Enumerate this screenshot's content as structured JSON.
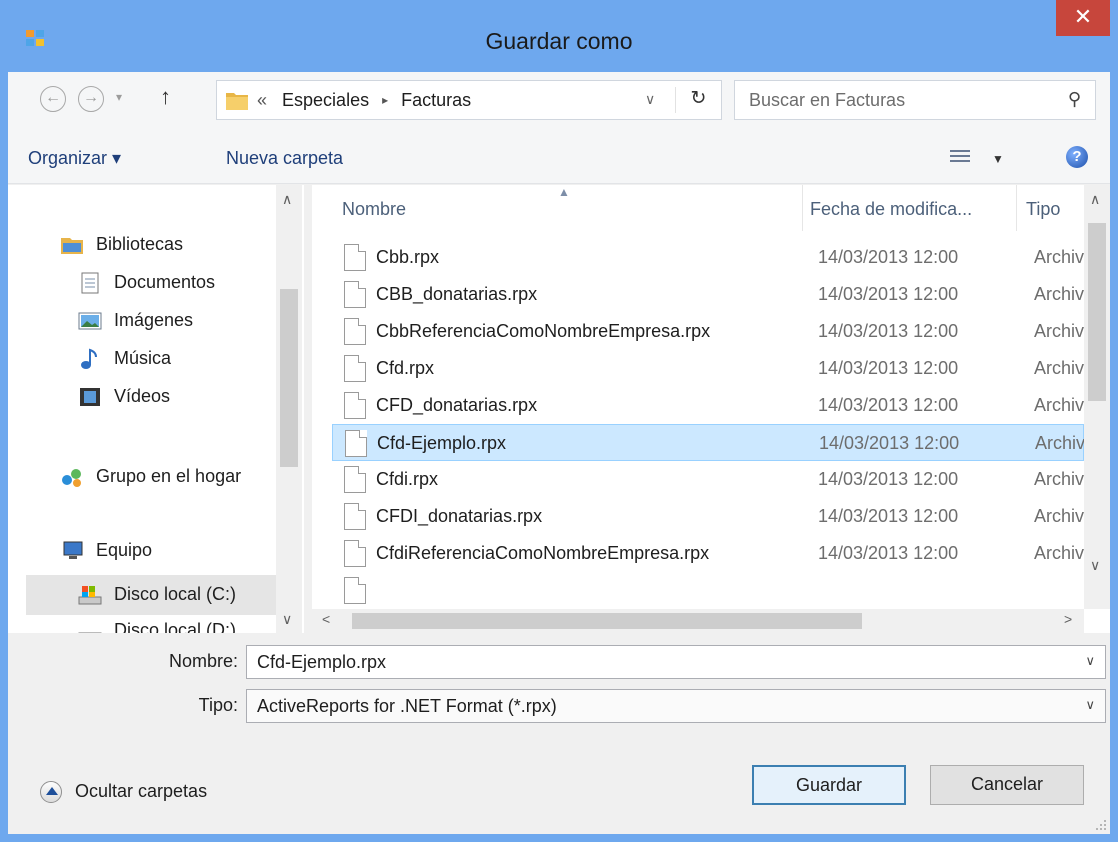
{
  "window": {
    "title": "Guardar como",
    "close_glyph": "✕"
  },
  "nav": {
    "back_glyph": "←",
    "forward_glyph": "→",
    "history_glyph": "▾",
    "up_glyph": "↑",
    "breadcrumb": {
      "overflow": "«",
      "items": [
        "Especiales",
        "Facturas"
      ],
      "separator": "▸"
    },
    "address_dropdown_glyph": "∨",
    "refresh_glyph": "↻",
    "search_placeholder": "Buscar en Facturas",
    "search_glyph": "⚲"
  },
  "toolbar": {
    "organize_label": "Organizar ▾",
    "new_folder_label": "Nueva carpeta",
    "views_dropdown_glyph": "▼",
    "help_glyph": "?"
  },
  "navpane": {
    "items": [
      {
        "label": "Bibliotecas",
        "icon": "libraries-icon"
      },
      {
        "label": "Documentos",
        "icon": "documents-icon"
      },
      {
        "label": "Imágenes",
        "icon": "pictures-icon"
      },
      {
        "label": "Música",
        "icon": "music-icon"
      },
      {
        "label": "Vídeos",
        "icon": "videos-icon"
      },
      {
        "label": "Grupo en el hogar",
        "icon": "homegroup-icon"
      },
      {
        "label": "Equipo",
        "icon": "computer-icon"
      },
      {
        "label": "Disco local (C:)",
        "icon": "drive-icon"
      },
      {
        "label": "Disco local (D:)",
        "icon": "drive-icon"
      }
    ],
    "selected": "Disco local (C:)"
  },
  "filelist": {
    "columns": {
      "name": "Nombre",
      "date": "Fecha de modifica...",
      "type": "Tipo"
    },
    "sort_glyph": "▲",
    "rows": [
      {
        "name": "Cbb.rpx",
        "date": "14/03/2013 12:00",
        "type": "Archiv"
      },
      {
        "name": "CBB_donatarias.rpx",
        "date": "14/03/2013 12:00",
        "type": "Archiv"
      },
      {
        "name": "CbbReferenciaComoNombreEmpresa.rpx",
        "date": "14/03/2013 12:00",
        "type": "Archiv"
      },
      {
        "name": "Cfd.rpx",
        "date": "14/03/2013 12:00",
        "type": "Archiv"
      },
      {
        "name": "CFD_donatarias.rpx",
        "date": "14/03/2013 12:00",
        "type": "Archiv"
      },
      {
        "name": "Cfd-Ejemplo.rpx",
        "date": "14/03/2013 12:00",
        "type": "Archiv"
      },
      {
        "name": "Cfdi.rpx",
        "date": "14/03/2013 12:00",
        "type": "Archiv"
      },
      {
        "name": "CFDI_donatarias.rpx",
        "date": "14/03/2013 12:00",
        "type": "Archiv"
      },
      {
        "name": "CfdiReferenciaComoNombreEmpresa.rpx",
        "date": "14/03/2013 12:00",
        "type": "Archiv"
      }
    ],
    "selected_row": "Cfd-Ejemplo.rpx"
  },
  "form": {
    "name_label": "Nombre:",
    "name_value": "Cfd-Ejemplo.rpx",
    "type_label": "Tipo:",
    "type_value": "ActiveReports for .NET Format (*.rpx)",
    "dropdown_glyph": "∨"
  },
  "footer": {
    "hide_folders_label": "Ocultar carpetas",
    "save_label": "Guardar",
    "cancel_label": "Cancelar"
  },
  "scroll_glyphs": {
    "up": "∧",
    "down": "∨",
    "left": "<",
    "right": ">"
  },
  "colors": {
    "titlebar": "#6ea8ee",
    "close": "#c7463c",
    "selection": "#cce8ff",
    "link": "#1f3f7a"
  }
}
